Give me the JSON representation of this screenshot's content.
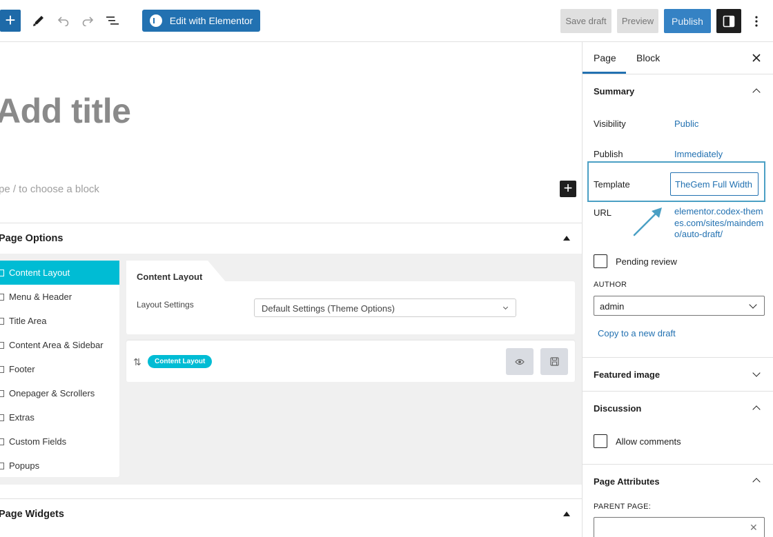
{
  "toolbar": {
    "add_icon": "plus-icon",
    "edit_elementor_label": "Edit with Elementor",
    "save_draft_label": "Save draft",
    "preview_label": "Preview",
    "publish_label": "Publish"
  },
  "editor": {
    "title_placeholder": "Add title",
    "block_placeholder": "pe / to choose a block"
  },
  "page_options": {
    "title": "Page Options",
    "nav": [
      {
        "label": "Content Layout"
      },
      {
        "label": "Menu & Header"
      },
      {
        "label": "Title Area"
      },
      {
        "label": "Content Area & Sidebar"
      },
      {
        "label": "Footer"
      },
      {
        "label": "Onepager & Scrollers"
      },
      {
        "label": "Extras"
      },
      {
        "label": "Custom Fields"
      },
      {
        "label": "Popups"
      }
    ],
    "card_title": "Content Layout",
    "layout_settings_label": "Layout Settings",
    "layout_settings_value": "Default Settings (Theme Options)",
    "preset_pill": "Content Layout"
  },
  "page_widgets": {
    "title": "Page Widgets"
  },
  "sidebar": {
    "tabs": [
      "Page",
      "Block"
    ],
    "summary": {
      "title": "Summary",
      "visibility_label": "Visibility",
      "visibility_value": "Public",
      "publish_label": "Publish",
      "publish_value": "Immediately",
      "template_label": "Template",
      "template_value": "TheGem Full Width",
      "url_label": "URL",
      "url_value": "elementor.codex-themes.com/sites/maindemo/auto-draft/",
      "pending_review_label": "Pending review",
      "author_label": "AUTHOR",
      "author_value": "admin",
      "copy_draft_label": "Copy to a new draft"
    },
    "featured_image_title": "Featured image",
    "discussion": {
      "title": "Discussion",
      "allow_comments_label": "Allow comments"
    },
    "page_attributes": {
      "title": "Page Attributes",
      "parent_page_label": "PARENT PAGE:"
    }
  },
  "colors": {
    "wp_blue": "#2271b1",
    "accent_cyan": "#00bcd4",
    "highlight_border": "#4a9fc4"
  }
}
